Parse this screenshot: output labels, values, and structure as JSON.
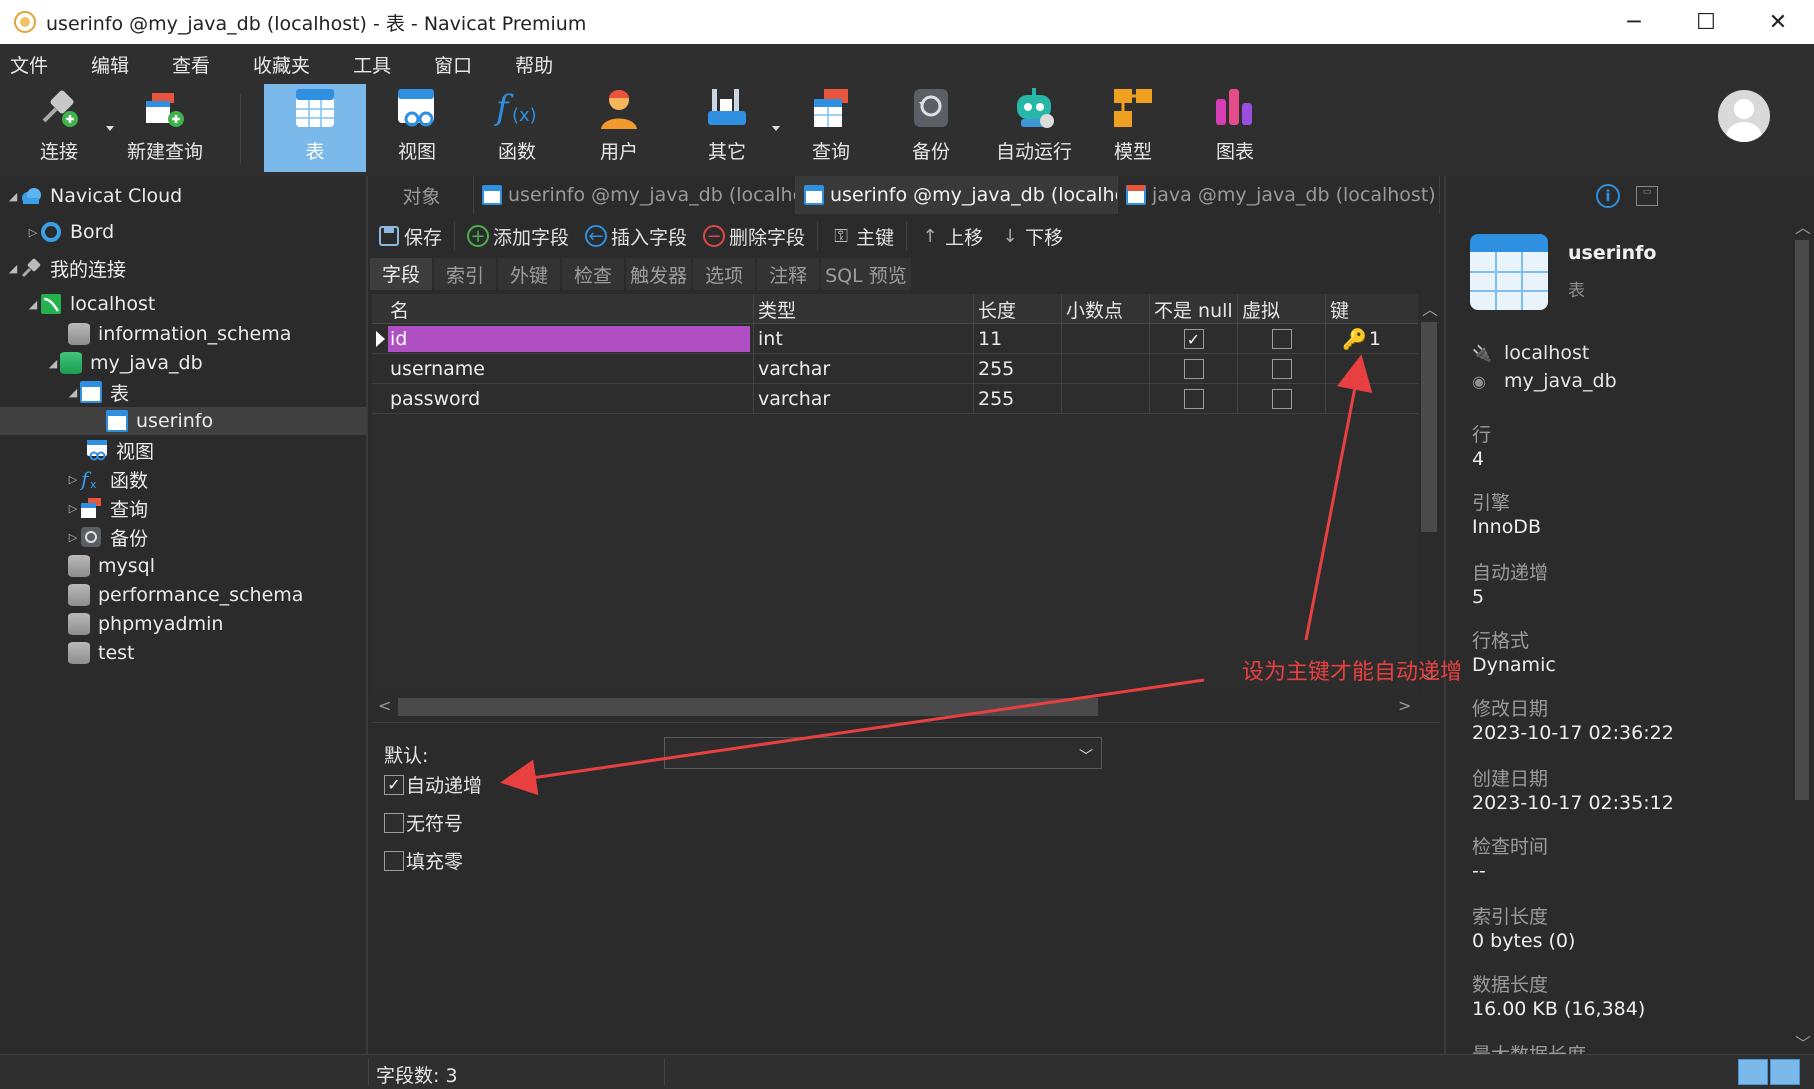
{
  "window": {
    "title": "userinfo @my_java_db (localhost) - 表 - Navicat Premium",
    "minimize": "─",
    "maximize": "☐",
    "close": "✕"
  },
  "menu": [
    "文件",
    "编辑",
    "查看",
    "收藏夹",
    "工具",
    "窗口",
    "帮助"
  ],
  "toolbar": {
    "connect": "连接",
    "new_query": "新建查询",
    "table": "表",
    "view": "视图",
    "function": "函数",
    "user": "用户",
    "other": "其它",
    "query": "查询",
    "backup": "备份",
    "automation": "自动运行",
    "model": "模型",
    "chart": "图表"
  },
  "nav": {
    "navicat_cloud": "Navicat Cloud",
    "bord": "Bord",
    "my_connections": "我的连接",
    "localhost": "localhost",
    "information_schema": "information_schema",
    "my_java_db": "my_java_db",
    "tables": "表",
    "userinfo": "userinfo",
    "views": "视图",
    "functions": "函数",
    "queries": "查询",
    "backups": "备份",
    "mysql": "mysql",
    "performance_schema": "performance_schema",
    "phpmyadmin": "phpmyadmin",
    "test": "test"
  },
  "tabs": {
    "objects": "对象",
    "tab1": "userinfo @my_java_db (localho...",
    "tab2": "userinfo @my_java_db (localho...",
    "tab3": "java @my_java_db (localhost) -..."
  },
  "editor_toolbar": {
    "save": "保存",
    "add_field": "添加字段",
    "insert_field": "插入字段",
    "delete_field": "删除字段",
    "primary_key": "主键",
    "move_up": "上移",
    "move_down": "下移"
  },
  "subtabs": [
    "字段",
    "索引",
    "外键",
    "检查",
    "触发器",
    "选项",
    "注释",
    "SQL 预览"
  ],
  "grid": {
    "headers": [
      "名",
      "类型",
      "长度",
      "小数点",
      "不是 null",
      "虚拟",
      "键"
    ],
    "rows": [
      {
        "name": "id",
        "type": "int",
        "length": "11",
        "decimals": "",
        "not_null": true,
        "virtual": false,
        "key": "1"
      },
      {
        "name": "username",
        "type": "varchar",
        "length": "255",
        "decimals": "",
        "not_null": false,
        "virtual": false,
        "key": ""
      },
      {
        "name": "password",
        "type": "varchar",
        "length": "255",
        "decimals": "",
        "not_null": false,
        "virtual": false,
        "key": ""
      }
    ]
  },
  "props": {
    "default_label": "默认:",
    "default_value": "",
    "auto_increment": "自动递增",
    "auto_increment_checked": true,
    "unsigned": "无符号",
    "unsigned_checked": false,
    "zerofill": "填充零",
    "zerofill_checked": false
  },
  "info": {
    "name": "userinfo",
    "type": "表",
    "connection": "localhost",
    "database": "my_java_db",
    "rows_label": "行",
    "rows": "4",
    "engine_label": "引擎",
    "engine": "InnoDB",
    "auto_inc_label": "自动递增",
    "auto_inc": "5",
    "row_format_label": "行格式",
    "row_format": "Dynamic",
    "modified_label": "修改日期",
    "modified": "2023-10-17 02:36:22",
    "created_label": "创建日期",
    "created": "2023-10-17 02:35:12",
    "check_time_label": "检查时间",
    "check_time": "--",
    "index_length_label": "索引长度",
    "index_length": "0 bytes (0)",
    "data_length_label": "数据长度",
    "data_length": "16.00 KB (16,384)",
    "max_data_length_label": "最大数据长度"
  },
  "status": {
    "field_count": "字段数: 3"
  },
  "annotation": {
    "text": "设为主键才能自动递增",
    "color": "#e84040"
  },
  "colors": {
    "accent": "#7cb9eb",
    "selected_cell": "#b04fc4",
    "key": "#f0b020"
  }
}
